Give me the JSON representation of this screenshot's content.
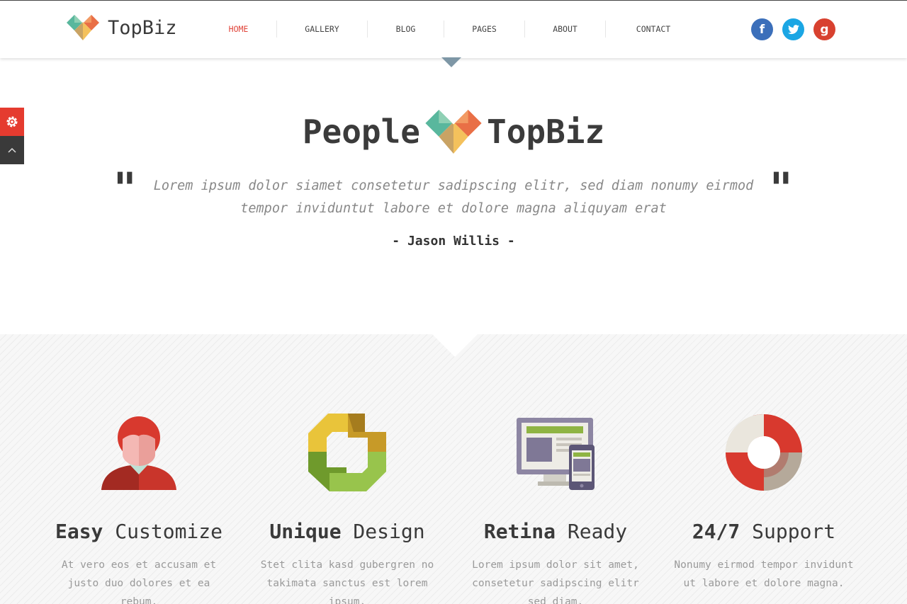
{
  "brand": {
    "name": "TopBiz"
  },
  "nav": {
    "items": [
      {
        "label": "HOME",
        "active": true
      },
      {
        "label": "GALLERY",
        "active": false
      },
      {
        "label": "BLOG",
        "active": false
      },
      {
        "label": "PAGES",
        "active": false
      },
      {
        "label": "ABOUT",
        "active": false
      },
      {
        "label": "CONTACT",
        "active": false
      }
    ]
  },
  "social": {
    "facebook": "f",
    "twitter": "t",
    "google": "g"
  },
  "icons": {
    "settings": "gear-icon",
    "scroll_top": "chevron-up-icon",
    "logo": "heart-diamond-logo"
  },
  "hero": {
    "word_left": "People",
    "word_right": "TopBiz",
    "quote_open": "\"",
    "quote_close": "\"",
    "quote": "Lorem ipsum dolor siamet consetetur sadipscing elitr, sed diam nonumy eirmod tempor inviduntut labore et dolore magna aliquyam erat",
    "author": "- Jason Willis -"
  },
  "features": [
    {
      "title_bold": "Easy",
      "title_rest": " Customize",
      "text": "At vero eos et accusam et justo duo dolores et ea rebum.",
      "icon": "user-icon"
    },
    {
      "title_bold": "Unique",
      "title_rest": " Design",
      "text": "Stet clita kasd gubergren no takimata sanctus est lorem ipsum.",
      "icon": "refresh-arrows-icon"
    },
    {
      "title_bold": "Retina",
      "title_rest": " Ready",
      "text": "Lorem ipsum dolor sit amet, consetetur sadipscing elitr sed diam.",
      "icon": "devices-icon"
    },
    {
      "title_bold": "24/7",
      "title_rest": " Support",
      "text": "Nonumy eirmod tempor invidunt ut labore et dolore magna.",
      "icon": "lifebuoy-icon"
    }
  ],
  "colors": {
    "accent": "#e0443a",
    "facebook": "#3b6fba",
    "twitter": "#1ba6e4",
    "google": "#d8412f",
    "text_dark": "#3a3a3a",
    "text_muted": "#9a9a9a"
  }
}
